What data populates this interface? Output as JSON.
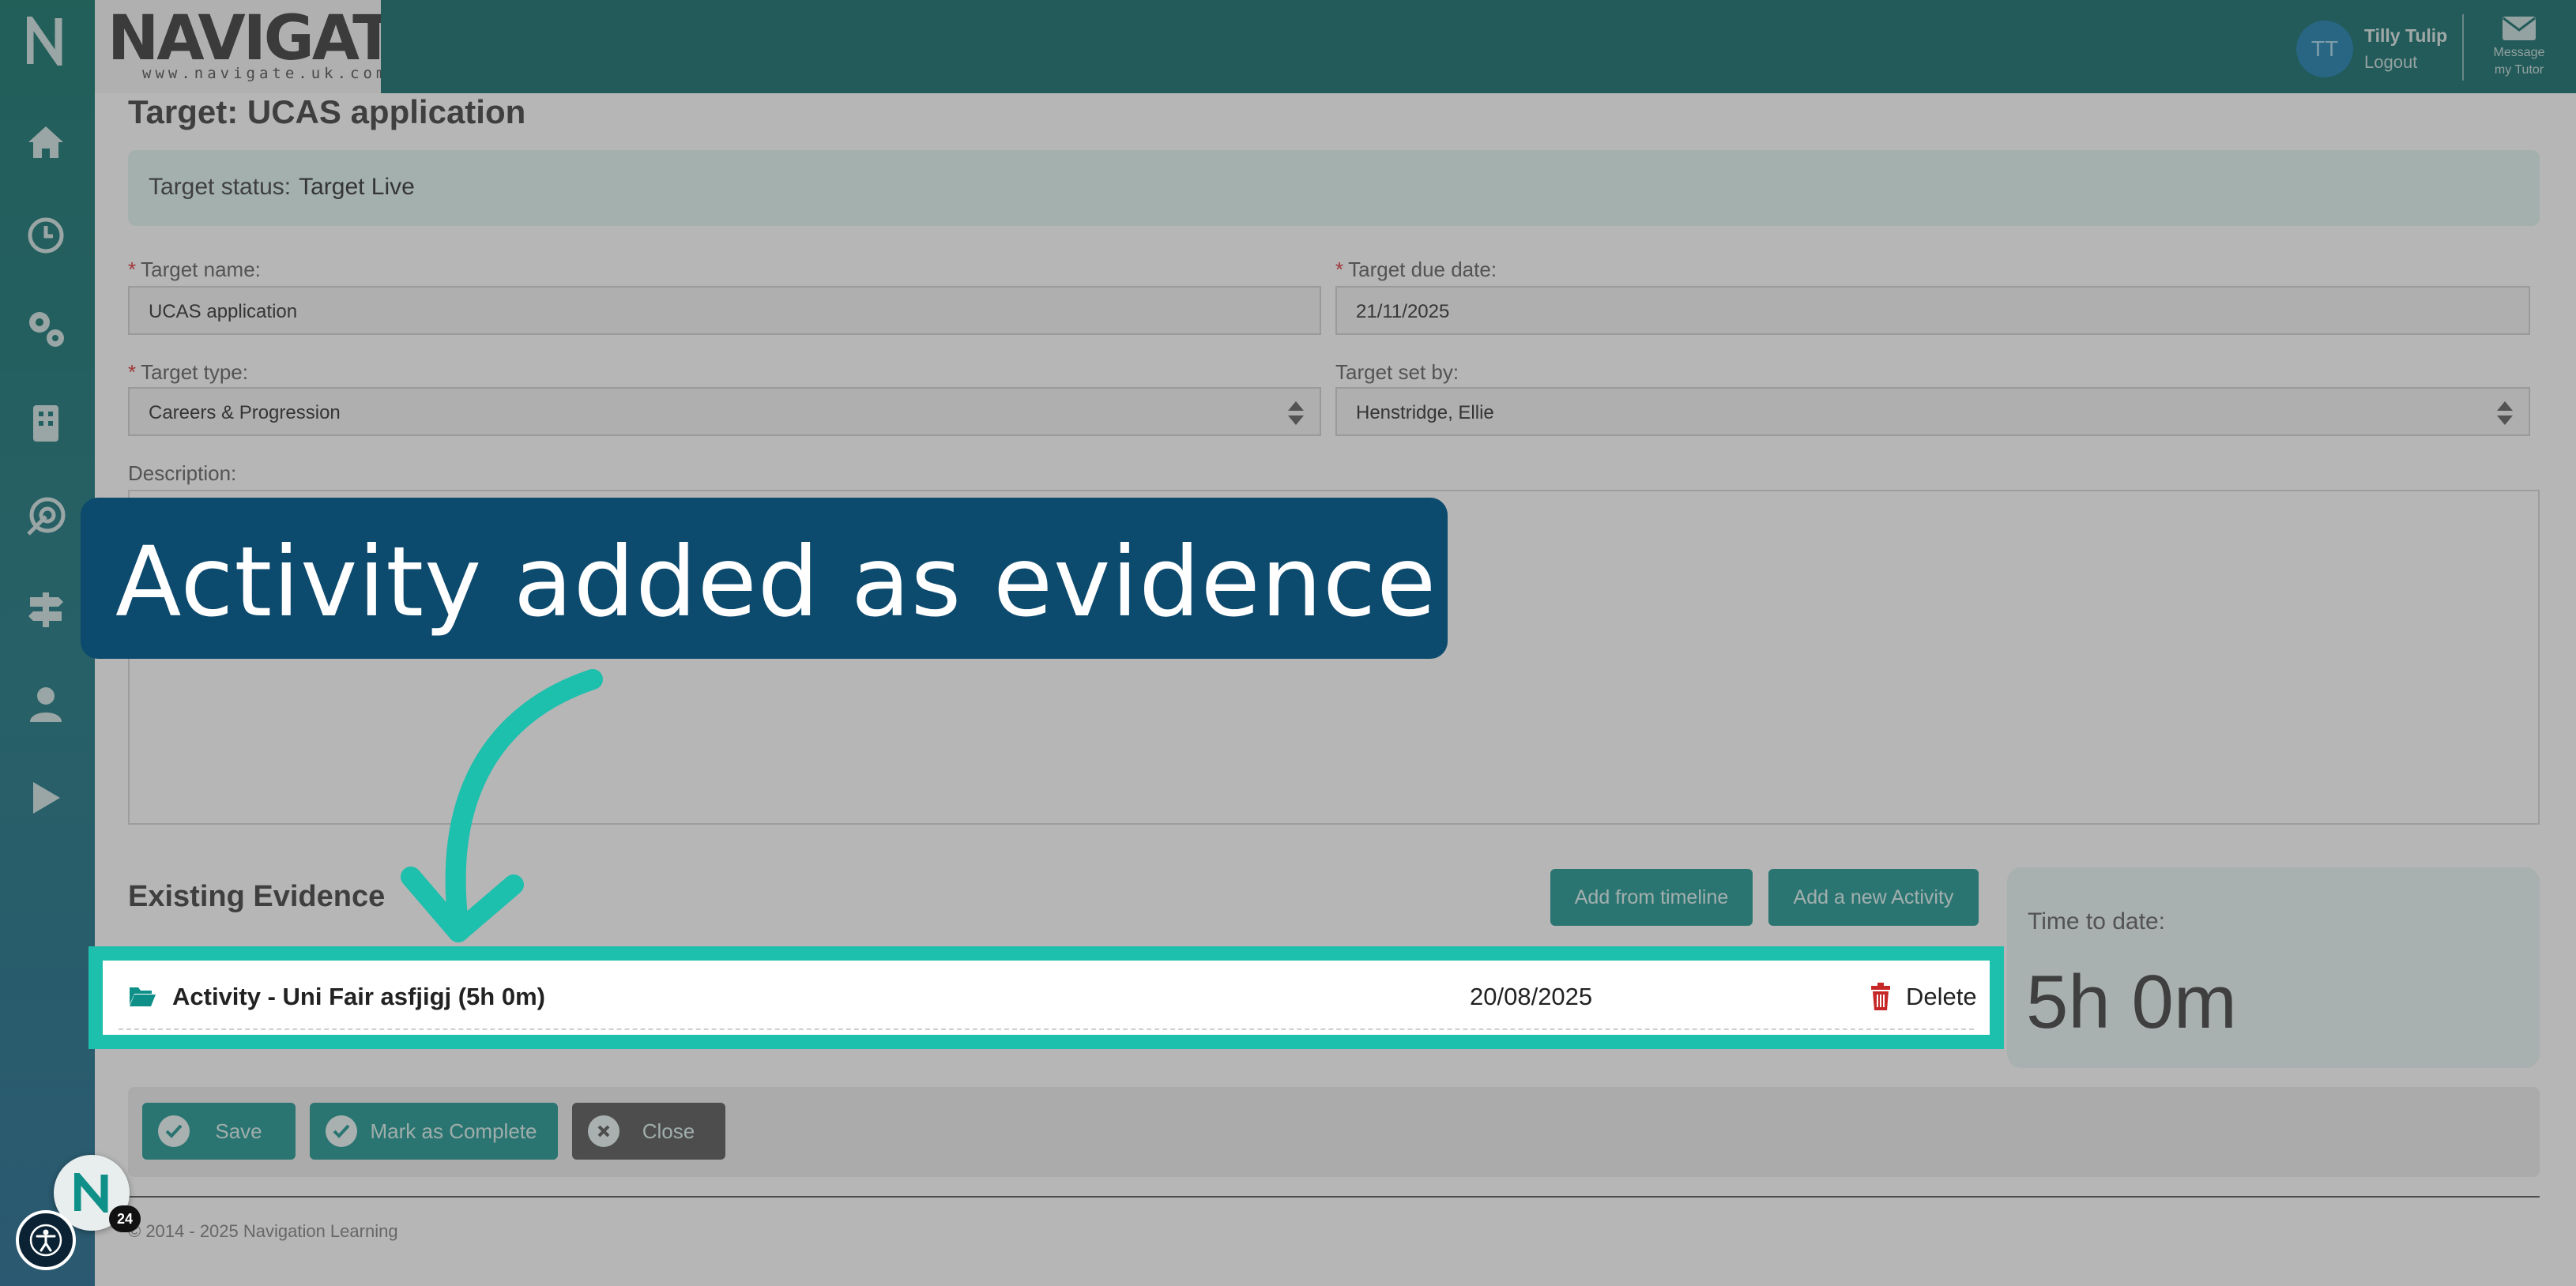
{
  "colors": {
    "topbar": "#00625f",
    "accent_teal": "#0e8f88",
    "highlight": "#1dbfad",
    "callout_bg": "#0c4a6e",
    "required": "#d9262b",
    "delete_icon": "#c62828"
  },
  "header": {
    "logo_text": "NAVIGATE",
    "logo_url": "www.navigate.uk.com",
    "user_initials": "TT",
    "user_name": "Tilly Tulip",
    "logout_label": "Logout",
    "message_line1": "Message",
    "message_line2": "my Tutor"
  },
  "sidebar": {
    "items": [
      {
        "icon": "navigate-logo-icon"
      },
      {
        "icon": "home-icon"
      },
      {
        "icon": "clock-icon"
      },
      {
        "icon": "gears-icon"
      },
      {
        "icon": "building-icon"
      },
      {
        "icon": "target-icon"
      },
      {
        "icon": "signpost-icon"
      },
      {
        "icon": "user-icon"
      },
      {
        "icon": "play-icon"
      }
    ]
  },
  "page": {
    "title": "Target: UCAS application",
    "status_label": "Target status:",
    "status_value": "Target Live"
  },
  "form": {
    "required_mark": "*",
    "target_name_label": "Target name:",
    "target_name_value": "UCAS application",
    "due_date_label": "Target due date:",
    "due_date_value": "21/11/2025",
    "target_type_label": "Target type:",
    "target_type_value": "Careers & Progression",
    "set_by_label": "Target set by:",
    "set_by_value": "Henstridge, Ellie",
    "description_label": "Description:"
  },
  "evidence": {
    "heading": "Existing Evidence",
    "add_from_timeline": "Add from timeline",
    "add_new_activity": "Add a new Activity",
    "items": [
      {
        "title": "Activity - Uni Fair asfjigj (5h 0m)",
        "date": "20/08/2025",
        "delete_label": "Delete"
      }
    ],
    "time_label": "Time to date:",
    "time_value": "5h 0m"
  },
  "actions": {
    "save": "Save",
    "mark_complete": "Mark as Complete",
    "close": "Close"
  },
  "footer": {
    "copyright": "© 2014 - 2025 Navigation Learning"
  },
  "callout": {
    "text": "Activity added as evidence"
  },
  "widgets": {
    "help_badge": "24"
  }
}
